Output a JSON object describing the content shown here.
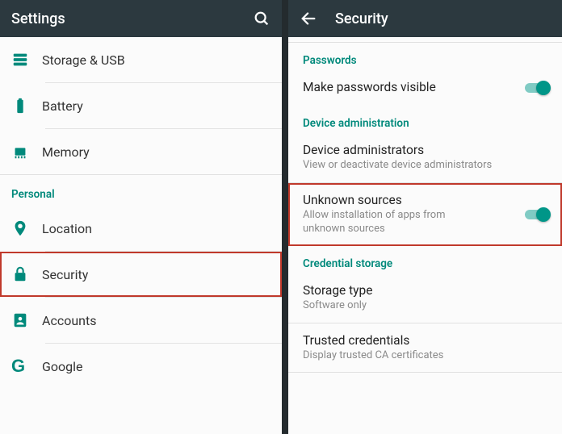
{
  "left": {
    "title": "Settings",
    "section_personal": "Personal",
    "items": {
      "storage": "Storage & USB",
      "battery": "Battery",
      "memory": "Memory",
      "location": "Location",
      "security": "Security",
      "accounts": "Accounts",
      "google": "Google"
    }
  },
  "right": {
    "title": "Security",
    "sections": {
      "passwords": "Passwords",
      "device_admin": "Device administration",
      "credential": "Credential storage"
    },
    "passwords_visible": {
      "title": "Make passwords visible"
    },
    "device_admins": {
      "title": "Device administrators",
      "sub": "View or deactivate device administrators"
    },
    "unknown_sources": {
      "title": "Unknown sources",
      "sub": "Allow installation of apps from unknown sources"
    },
    "storage_type": {
      "title": "Storage type",
      "sub": "Software only"
    },
    "trusted": {
      "title": "Trusted credentials",
      "sub": "Display trusted CA certificates"
    }
  }
}
